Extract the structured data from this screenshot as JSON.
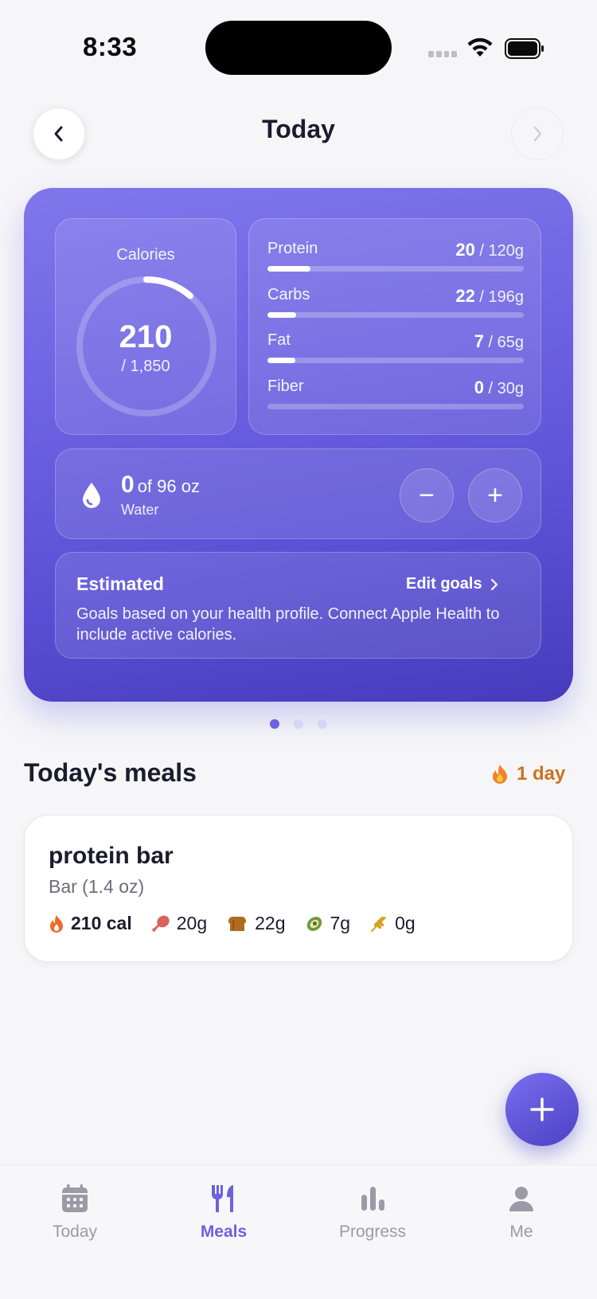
{
  "status_bar": {
    "time": "8:33"
  },
  "header": {
    "title": "Today"
  },
  "summary": {
    "calories": {
      "label": "Calories",
      "value": "210",
      "goal": "/ 1,850",
      "progress": 0.1135
    },
    "macros": [
      {
        "name": "Protein",
        "value": "20",
        "goal": " / 120g",
        "progress": 0.167
      },
      {
        "name": "Carbs",
        "value": "22",
        "goal": " / 196g",
        "progress": 0.112
      },
      {
        "name": "Fat",
        "value": "7",
        "goal": " / 65g",
        "progress": 0.108
      },
      {
        "name": "Fiber",
        "value": "0",
        "goal": " / 30g",
        "progress": 0.0
      }
    ],
    "water": {
      "amount": "0",
      "of": "of 96 oz",
      "label": "Water",
      "minus": "−",
      "plus": "+"
    },
    "estimated": {
      "title": "Estimated",
      "edit_label": "Edit goals",
      "description": "Goals based on your health profile. Connect Apple Health to include active calories."
    },
    "pager": {
      "count": 3,
      "active": 0
    }
  },
  "meals_section": {
    "title": "Today's meals",
    "streak": "1 day"
  },
  "meals": [
    {
      "name": "protein bar",
      "serving": "Bar (1.4 oz)",
      "calories": "210 cal",
      "protein": "20g",
      "carbs": "22g",
      "fat": "7g",
      "fiber": "0g"
    }
  ],
  "tabbar": {
    "items": [
      {
        "label": "Today",
        "icon": "calendar-icon"
      },
      {
        "label": "Meals",
        "icon": "fork-knife-icon"
      },
      {
        "label": "Progress",
        "icon": "bar-chart-icon"
      },
      {
        "label": "Me",
        "icon": "person-icon"
      }
    ],
    "active": "Meals"
  },
  "colors": {
    "accent": "#6c61e0",
    "streak": "#c9731f",
    "protein_icon": "#d9625a",
    "carbs_icon": "#b06b22",
    "fat_icon": "#6a9b3a",
    "fiber_icon": "#d4a21e",
    "calorie_icon": "#ef6a2b"
  }
}
